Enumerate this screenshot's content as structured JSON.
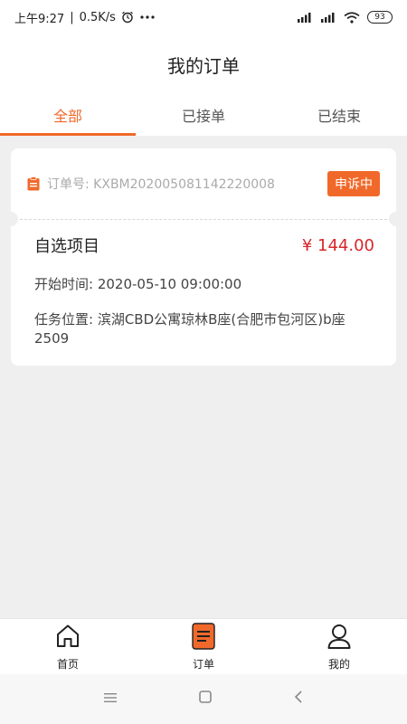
{
  "status": {
    "time": "上午9:27",
    "speed": "0.5K/s",
    "battery": "93"
  },
  "header": {
    "title": "我的订单"
  },
  "tabs": [
    {
      "label": "全部",
      "active": true
    },
    {
      "label": "已接单",
      "active": false
    },
    {
      "label": "已结束",
      "active": false
    }
  ],
  "order": {
    "number": "订单号: KXBM202005081142220008",
    "badge": "申诉中",
    "item": "自选项目",
    "price": "¥ 144.00",
    "start_time": "开始时间: 2020-05-10 09:00:00",
    "location": "任务位置: 滨湖CBD公寓琼林B座(合肥市包河区)b座2509"
  },
  "nav": [
    {
      "label": "首页",
      "icon": "home-icon"
    },
    {
      "label": "订单",
      "icon": "order-icon"
    },
    {
      "label": "我的",
      "icon": "profile-icon"
    }
  ],
  "colors": {
    "accent": "#f0692a",
    "price": "#d8262a"
  }
}
